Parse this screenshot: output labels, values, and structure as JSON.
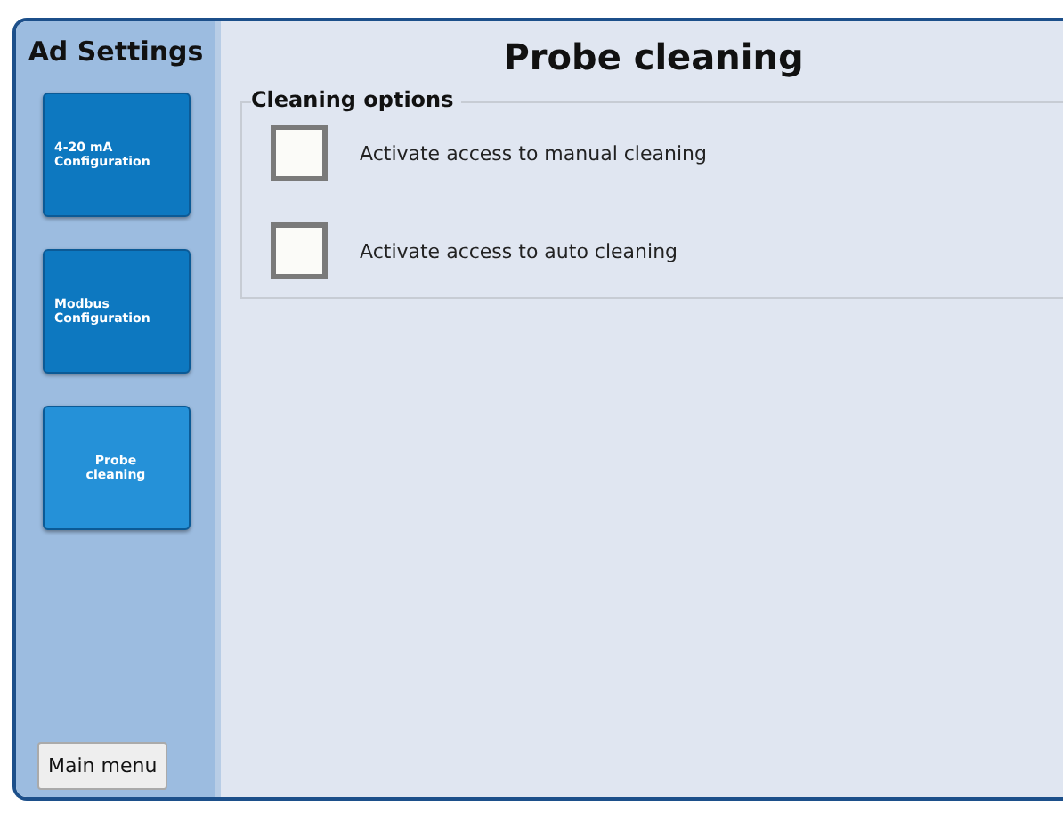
{
  "sidebar": {
    "title": "Ad Settings",
    "items": [
      {
        "label": "4-20 mA\nConfiguration",
        "selected": false
      },
      {
        "label": "Modbus\nConfiguration",
        "selected": false
      },
      {
        "label": "Probe\ncleaning",
        "selected": true
      }
    ],
    "main_menu_button": "Main menu"
  },
  "page_title": "Probe cleaning",
  "group": {
    "title": "Cleaning options",
    "options": [
      {
        "label": "Activate access to manual cleaning",
        "checked": false
      },
      {
        "label": "Activate access to auto cleaning",
        "checked": false
      }
    ]
  }
}
